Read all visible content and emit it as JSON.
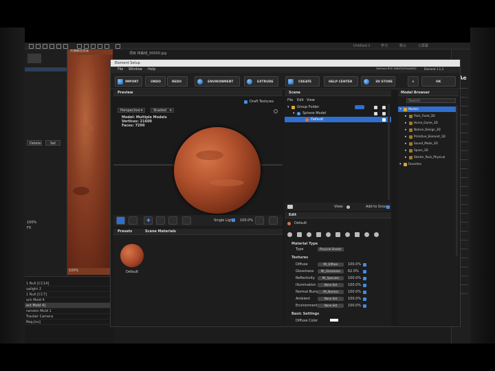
{
  "host": {
    "title": "Unnamed Project",
    "file_tab": "项目 待曲线_00000.jpg",
    "top_right_items": [
      "Untitled 1",
      "学习",
      "默认",
      "小屏幕"
    ],
    "project_panel": {
      "buttons": [
        "Delete",
        "Set"
      ],
      "rows": [
        "100%",
        "FX"
      ]
    },
    "comp_tab": "大便最佳合成",
    "comp_zoom": "100%",
    "timeline": {
      "rows": [
        "1 Null [CC14]",
        "ualight 2",
        "1 Null [CC7]",
        "sch Mold 4",
        "ect Mold 4]",
        "ransion Mold 1",
        "Tracker Camera",
        "Reg.Jnu]"
      ]
    },
    "right_panel": {
      "rows": [
        "Ae",
        "",
        "",
        "",
        "",
        "",
        "",
        "",
        "",
        "",
        "",
        ""
      ]
    }
  },
  "plugin": {
    "title": "Element Setup",
    "gpu": "GeForce RTX 3060Ti/PCIe/SSE2",
    "gpu_sub": "0.0 GB 18.8 GHz 3.00",
    "render_status": "Element  1.1.3",
    "menu": [
      "File",
      "Window",
      "Help"
    ],
    "toolbar": {
      "import": "IMPORT",
      "undo": "UNDO",
      "redo": "REDO",
      "environment": "ENVIRONMENT",
      "extrude": "EXTRUDE",
      "create": "CREATE",
      "help_center": "HELP CENTER",
      "store": "3D STORE",
      "ok": "OK"
    },
    "preview": {
      "header": "Preview",
      "draft_textures": "Draft Textures",
      "view_mode": "Perspective",
      "shade_mode": "Shaded",
      "stats": [
        "Model:  Multiple Models",
        "Vertices:  21600",
        "Faces:  7200"
      ],
      "single_light": "Single Light",
      "zoom": "100.0%"
    },
    "scene": {
      "header": "Scene",
      "menu": [
        "File",
        "Edit",
        "View"
      ],
      "items": [
        {
          "label": "Group Folder",
          "indent": 0
        },
        {
          "label": "Sphere Model",
          "indent": 1
        },
        {
          "label": "Default",
          "indent": 2
        }
      ],
      "view_label": "View:",
      "add_to_group": "Add to Group"
    },
    "presets": {
      "header": "Presets",
      "scene_materials": "Scene Materials",
      "swatch_label": "Default"
    },
    "edit": {
      "header": "Edit",
      "material_name": "Default",
      "material_type_section": "Material Type",
      "type_label": "Type",
      "type_value": "Physical Shader",
      "texture_section": "Textures",
      "textures": [
        {
          "name": "Diffuse",
          "map": "Mr_Diffuse",
          "value": "100.0%"
        },
        {
          "name": "Glossiness",
          "map": "Mr_Glossiness",
          "value": "62.0%"
        },
        {
          "name": "Reflectivity",
          "map": "Mr_Specular",
          "value": "100.0%"
        },
        {
          "name": "Illumination",
          "map": "None Set",
          "value": "100.0%"
        },
        {
          "name": "Normal Bump",
          "map": "Mr_Normal",
          "value": "100.0%"
        },
        {
          "name": "Ambient",
          "map": "None Set",
          "value": "100.0%"
        },
        {
          "name": "Environment",
          "map": "None Set",
          "value": "100.0%"
        }
      ],
      "basic_settings": "Basic Settings",
      "diffuse_color": "Diffuse Color"
    },
    "model_browser": {
      "header": "Model Browser",
      "search_placeholder": "Search",
      "items": [
        {
          "label": "Models",
          "level": 0
        },
        {
          "label": "Pack_Fixed_3D",
          "level": 1
        },
        {
          "label": "Horse_Game_3D",
          "level": 1
        },
        {
          "label": "Nature_Design_3D",
          "level": 1
        },
        {
          "label": "Primitive_Element_3D",
          "level": 1
        },
        {
          "label": "Sound_Made_3D",
          "level": 1
        },
        {
          "label": "Space_3D",
          "level": 1
        },
        {
          "label": "Starter_Pack_Physical",
          "level": 1
        },
        {
          "label": "Favorites",
          "level": 0
        }
      ]
    },
    "colors": {
      "accent_blue": "#2f7fd6",
      "planet": "#b4532e",
      "selected_row": "#2f6fd0"
    }
  }
}
